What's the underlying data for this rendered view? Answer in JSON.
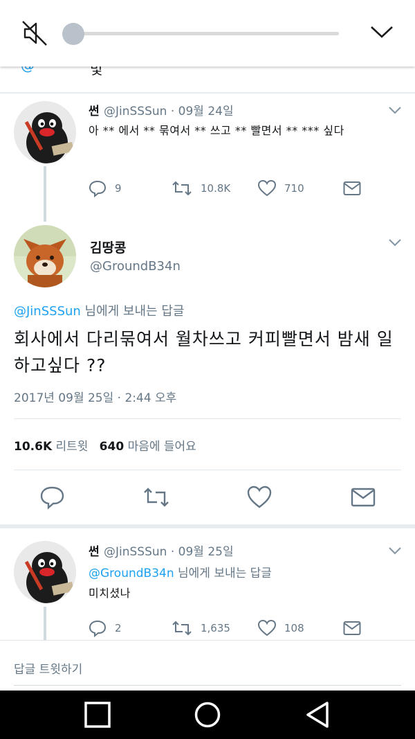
{
  "media": {
    "mute_icon": "speaker-muted-icon",
    "seek_progress": 0.0,
    "collapse_icon": "chevron-down-icon"
  },
  "tweet1": {
    "name": "썬",
    "handle": "@JinSSSun",
    "date": "· 09월 24일",
    "text": "아 ** 에서 ** 묶여서 ** 쓰고 ** 빨면서 ** *** 싶다",
    "replies": "9",
    "retweets": "10.8K",
    "likes": "710"
  },
  "main": {
    "name": "김땅콩",
    "handle": "@GroundB34n",
    "reply_to_handle": "@JinSSSun",
    "reply_to_suffix": " 님에게 보내는 답글",
    "text": "회사에서 다리묶여서 월차쓰고 커피빨면서 밤새 일하고싶다 ??",
    "date": "2017년 09월 25일 · 2:44 오후",
    "retweet_count": "10.6K",
    "retweet_label": "리트윗",
    "like_count": "640",
    "like_label": "마음에 들어요"
  },
  "tweet3": {
    "name": "썬",
    "handle": "@JinSSSun",
    "date": "· 09월 25일",
    "reply_to_handle": "@GroundB34n",
    "reply_to_suffix": " 님에게 보내는 답글",
    "text": "미치셨나",
    "replies": "2",
    "retweets": "1,635",
    "likes": "108"
  },
  "reply_bar": {
    "placeholder": "답글 트윗하기"
  },
  "colors": {
    "link": "#1da1f2",
    "secondary": "#657786",
    "navbar": "#000000"
  }
}
